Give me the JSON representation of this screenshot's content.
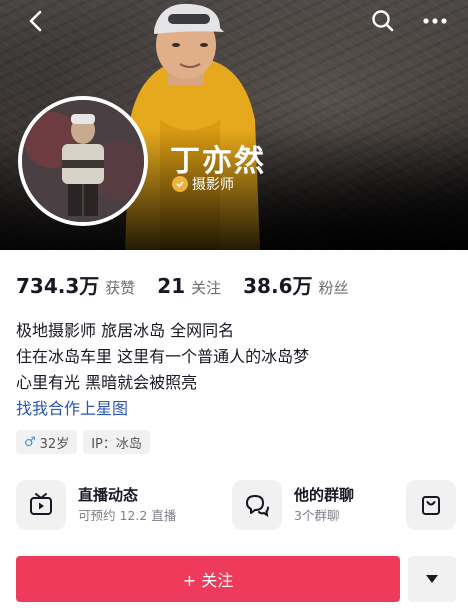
{
  "profile": {
    "name": "丁亦然",
    "verified_title": "摄影师",
    "stats": [
      {
        "value": "734.3万",
        "label": "获赞"
      },
      {
        "value": "21",
        "label": "关注"
      },
      {
        "value": "38.6万",
        "label": "粉丝"
      }
    ],
    "bio": [
      "极地摄影师 旅居冰岛 全网同名",
      "住在冰岛车里 这里有一个普通人的冰岛梦",
      "心里有光 黑暗就会被照亮"
    ],
    "bio_link": "找我合作上星图",
    "tags": {
      "gender_symbol": "♂",
      "age": "32岁",
      "ip": "IP：冰岛"
    }
  },
  "cards": [
    {
      "title": "直播动态",
      "sub": "可预约 12.2 直播",
      "icon": "live-tv-icon"
    },
    {
      "title": "他的群聊",
      "sub": "3个群聊",
      "icon": "group-chat-icon"
    },
    {
      "icon": "shopping-bag-icon"
    }
  ],
  "actions": {
    "follow_label": "+ 关注",
    "dropdown_icon": "triangle-down-icon"
  },
  "colors": {
    "follow_button": "#ee3b5b",
    "verify_badge": "#f0b33a",
    "link": "#2a56b8"
  }
}
